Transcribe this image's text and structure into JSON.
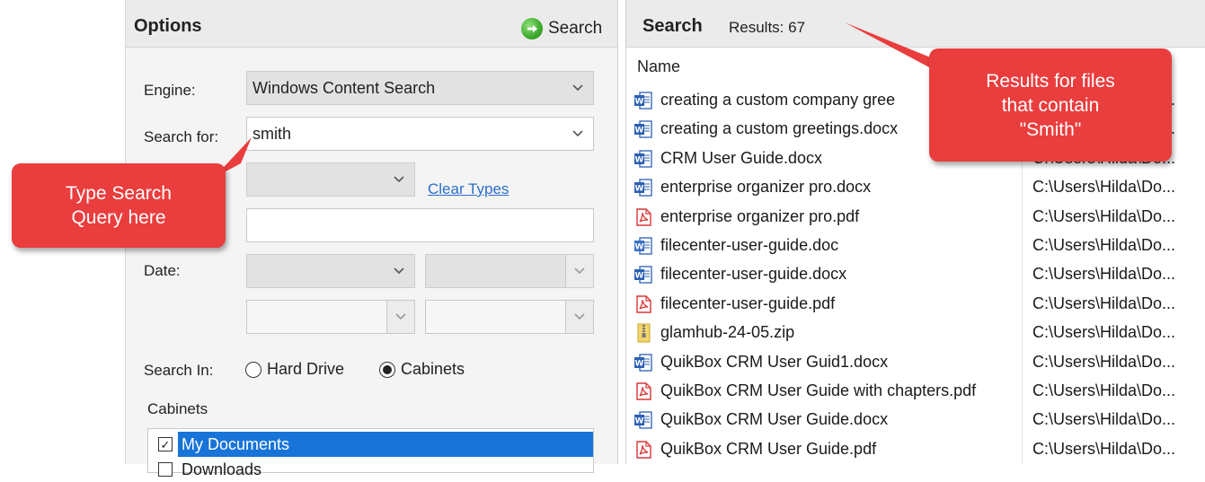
{
  "options": {
    "title": "Options",
    "search_button": "Search",
    "engine_label": "Engine:",
    "engine_value": "Windows Content Search",
    "search_for_label": "Search for:",
    "search_for_value": "smith",
    "clear_types": "Clear Types",
    "date_label": "Date:",
    "search_in_label": "Search In:",
    "radio_hard_drive": "Hard Drive",
    "radio_cabinets": "Cabinets",
    "cabinets_label": "Cabinets",
    "cabinet_items": [
      "My Documents",
      "Downloads"
    ]
  },
  "results": {
    "title": "Search",
    "count": "Results: 67",
    "column_name": "Name",
    "rows": [
      {
        "name": "creating a  custom company gree",
        "path": "C:\\Users\\Hilda\\Do...",
        "type": "docx"
      },
      {
        "name": "creating a custom greetings.docx",
        "path": "C:\\Users\\Hilda\\Do...",
        "type": "docx"
      },
      {
        "name": "CRM User Guide.docx",
        "path": "C:\\Users\\Hilda\\Do...",
        "type": "docx"
      },
      {
        "name": "enterprise organizer pro.docx",
        "path": "C:\\Users\\Hilda\\Do...",
        "type": "docx"
      },
      {
        "name": "enterprise organizer pro.pdf",
        "path": "C:\\Users\\Hilda\\Do...",
        "type": "pdf"
      },
      {
        "name": "filecenter-user-guide.doc",
        "path": "C:\\Users\\Hilda\\Do...",
        "type": "doc"
      },
      {
        "name": "filecenter-user-guide.docx",
        "path": "C:\\Users\\Hilda\\Do...",
        "type": "docx"
      },
      {
        "name": "filecenter-user-guide.pdf",
        "path": "C:\\Users\\Hilda\\Do...",
        "type": "pdf"
      },
      {
        "name": "glamhub-24-05.zip",
        "path": "C:\\Users\\Hilda\\Do...",
        "type": "zip"
      },
      {
        "name": "QuikBox CRM User Guid1.docx",
        "path": "C:\\Users\\Hilda\\Do...",
        "type": "docx"
      },
      {
        "name": "QuikBox CRM User Guide with chapters.pdf",
        "path": "C:\\Users\\Hilda\\Do...",
        "type": "pdf"
      },
      {
        "name": "QuikBox CRM User Guide.docx",
        "path": "C:\\Users\\Hilda\\Do...",
        "type": "docx"
      },
      {
        "name": "QuikBox CRM User Guide.pdf",
        "path": "C:\\Users\\Hilda\\Do...",
        "type": "pdf"
      }
    ]
  },
  "callouts": {
    "left_line1": "Type Search",
    "left_line2": "Query here",
    "right_line1": "Results for files",
    "right_line2": "that contain",
    "right_line3": "\"Smith\""
  },
  "icons": {
    "go": "go-arrow-icon",
    "docx": "word-doc-icon",
    "pdf": "pdf-icon",
    "zip": "zip-archive-icon"
  },
  "colors": {
    "callout": "#ea3d3d",
    "selection": "#1874d8",
    "link": "#2a6fc7",
    "word_blue": "#2b5fb3",
    "pdf_red": "#d93636"
  }
}
